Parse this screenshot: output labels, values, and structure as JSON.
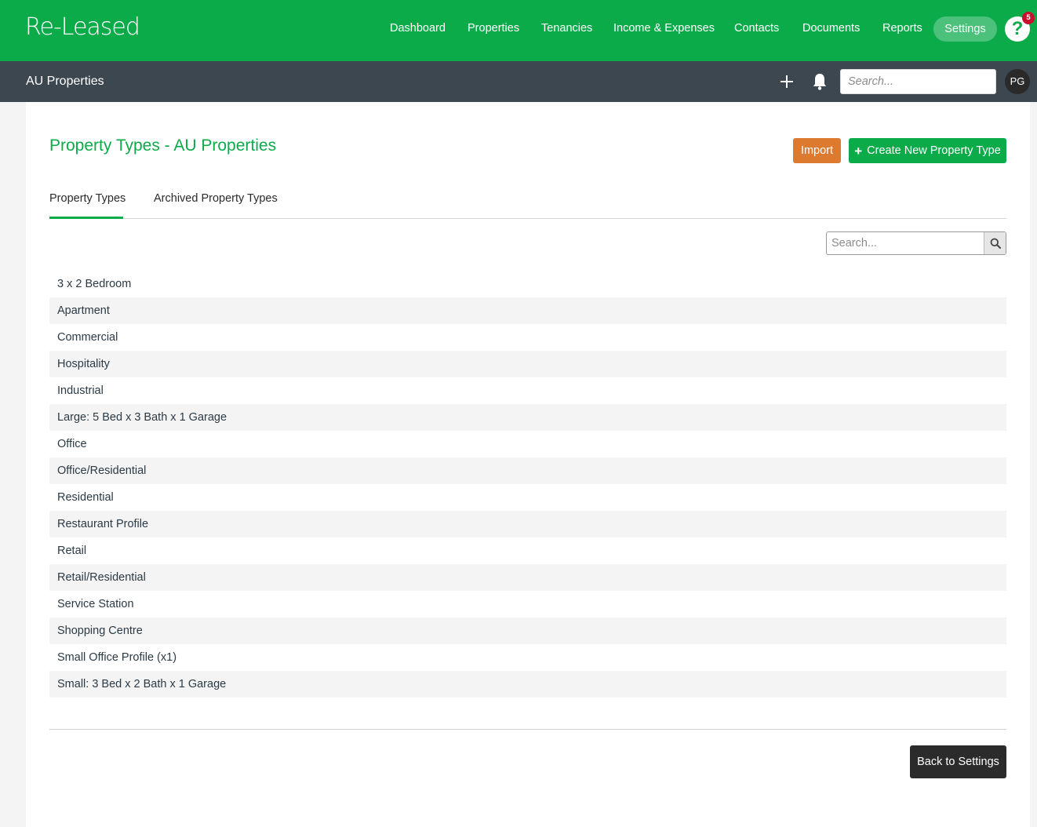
{
  "app": {
    "logo": "Re-Leased"
  },
  "nav": {
    "items": [
      "Dashboard",
      "Properties",
      "Tenancies",
      "Income & Expenses",
      "Contacts",
      "Documents",
      "Reports"
    ],
    "settings": "Settings",
    "help_label": "?",
    "help_badge": "5"
  },
  "subbar": {
    "title": "AU Properties",
    "search_placeholder": "Search...",
    "avatar_initials": "PG"
  },
  "page": {
    "title": "Property Types - AU Properties",
    "import_label": "Import",
    "create_label": "Create New Property Type",
    "tabs": [
      "Property Types",
      "Archived Property Types"
    ],
    "list_search_placeholder": "Search...",
    "items": [
      "3 x 2 Bedroom",
      "Apartment",
      "Commercial",
      "Hospitality",
      "Industrial",
      "Large: 5 Bed x 3 Bath x 1 Garage",
      "Office",
      "Office/Residential",
      "Residential",
      "Restaurant Profile",
      "Retail",
      "Retail/Residential",
      "Service Station",
      "Shopping Centre",
      "Small Office Profile (x1)",
      "Small: 3 Bed x 2 Bath x 1 Garage"
    ],
    "back_label": "Back to Settings"
  },
  "colors": {
    "brand_green": "#0cab49",
    "subbar": "#3d474f",
    "import_orange": "#dc7a30",
    "badge_red": "#c8102e"
  }
}
